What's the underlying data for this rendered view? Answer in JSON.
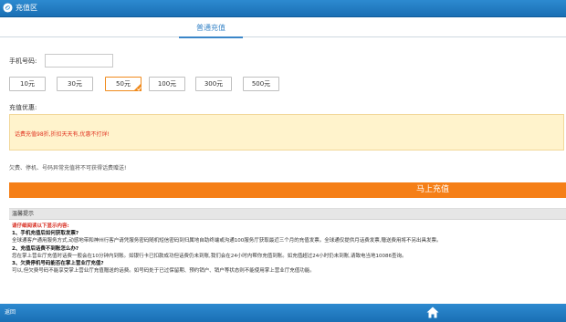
{
  "header": {
    "title": "充值区",
    "logo_icon": "china-mobile-logo-icon"
  },
  "tabs": [
    {
      "label": "普通充值",
      "active": true
    }
  ],
  "form": {
    "phone_label": "手机号码:",
    "phone_value": "",
    "phone_placeholder": ""
  },
  "amounts": [
    {
      "label": "10元",
      "selected": false
    },
    {
      "label": "30元",
      "selected": false
    },
    {
      "label": "50元",
      "selected": true
    },
    {
      "label": "100元",
      "selected": false
    },
    {
      "label": "300元",
      "selected": false
    },
    {
      "label": "500元",
      "selected": false
    }
  ],
  "promo": {
    "title": "充值优惠:",
    "text": "话费充值98折,折扣天天有,优惠不打烊!"
  },
  "notice": "欠费、停机、号码异常充值将不可获得话费赠送!",
  "recharge_button": "马上充值",
  "tips": {
    "header": "温馨提示",
    "warning": "请仔细阅读以下显示内容:",
    "items": [
      {
        "q": "1、手机充值后如何获取发票?",
        "a": "全球通客户通用服务方式,动感地带和神州行客户请凭服务密码随机短信密码到归属地自助终端或沟通100服务厅获取最近三个月的充值发票。全球通仅提供月话费发票,赠送费用将不另出具发票。"
      },
      {
        "q": "2、充值后话费不到账怎么办?",
        "a": "您在掌上营业厅充值时话费一般会在10分钟内到账。如银行卡已扣款成功但话费仍未到账,我们会在24小时内帮你充值到账。如充值超过24小时仍未到账,请致电当地10086查询。"
      },
      {
        "q": "3、欠费停机号码能否在掌上营业厅充值?",
        "a": "可以,但欠费号码不能享受掌上营业厅充值赠送的话费。如号码处于已过保留期、预约销户、销户等状态则不能使用掌上营业厅充值功能。"
      }
    ]
  },
  "footer": {
    "back_label": "返回",
    "home_icon": "home-icon"
  },
  "colors": {
    "brand_blue": "#1a6fb4",
    "accent_orange": "#f57f17",
    "promo_bg": "#fff3cc",
    "warning_red": "#d72b1f"
  }
}
